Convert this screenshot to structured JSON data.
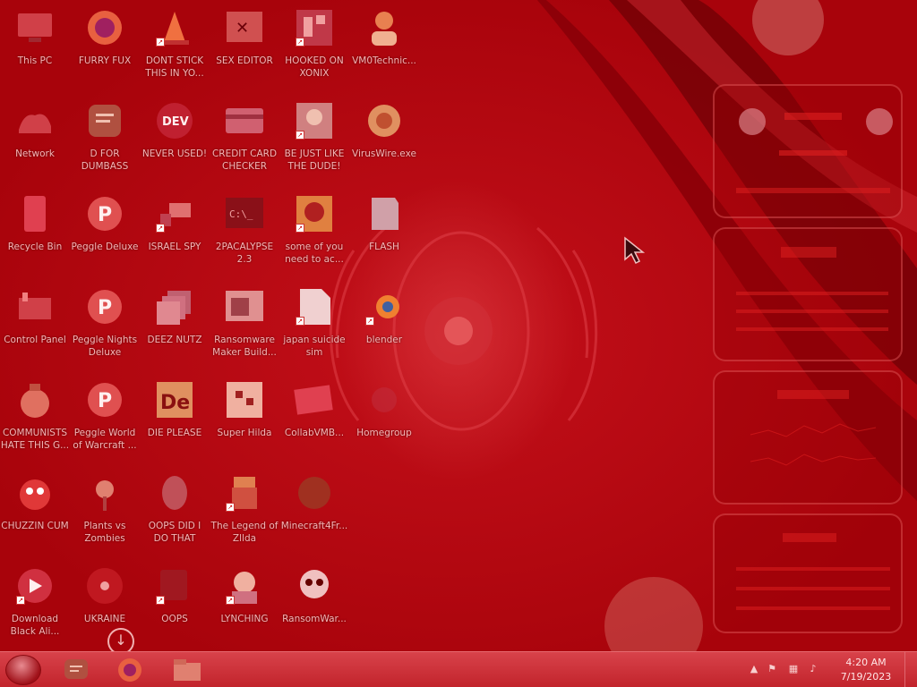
{
  "desktop": {
    "icons": [
      {
        "label": "This PC",
        "icon": "computer-icon"
      },
      {
        "label": "FURRY FUX",
        "icon": "firefox-icon"
      },
      {
        "label": "DONT STICK THIS IN YO...",
        "icon": "vlc-cone-icon"
      },
      {
        "label": "SEX EDITOR",
        "icon": "hex-editor-icon"
      },
      {
        "label": "HOOKED ON XONIX",
        "icon": "game-icon"
      },
      {
        "label": "VM0Technic...",
        "icon": "person-icon"
      },
      {
        "label": "Network",
        "icon": "network-icon"
      },
      {
        "label": "D FOR DUMBASS",
        "icon": "document-icon"
      },
      {
        "label": "NEVER USED!",
        "icon": "dev-badge-icon"
      },
      {
        "label": "CREDIT CARD CHECKER",
        "icon": "credit-card-icon"
      },
      {
        "label": "BE JUST LIKE THE DUDE!",
        "icon": "character-icon"
      },
      {
        "label": "VirusWire.exe",
        "icon": "virus-icon"
      },
      {
        "label": "Recycle Bin",
        "icon": "recycle-bin-icon"
      },
      {
        "label": "Peggle Deluxe",
        "icon": "peggle-icon"
      },
      {
        "label": "ISRAEL SPY",
        "icon": "spy-icon"
      },
      {
        "label": "2PACALYPSE 2.3",
        "icon": "terminal-icon"
      },
      {
        "label": "some of you need to ac...",
        "icon": "creature-icon"
      },
      {
        "label": "FLASH",
        "icon": "flash-icon"
      },
      {
        "label": "Control Panel",
        "icon": "control-panel-icon"
      },
      {
        "label": "Peggle Nights Deluxe",
        "icon": "peggle-icon"
      },
      {
        "label": "DEEZ NUTZ",
        "icon": "stack-icon"
      },
      {
        "label": "Ransomware Maker Build...",
        "icon": "window-icon"
      },
      {
        "label": "japan suicide sim",
        "icon": "file-icon"
      },
      {
        "label": "blender",
        "icon": "blender-icon"
      },
      {
        "label": "COMMUNISTS HATE THIS G...",
        "icon": "money-bag-icon"
      },
      {
        "label": "Peggle World of Warcraft ...",
        "icon": "peggle-icon"
      },
      {
        "label": "DIE PLEASE",
        "icon": "de-logo-icon"
      },
      {
        "label": "Super Hilda",
        "icon": "pixel-game-icon"
      },
      {
        "label": "CollabVMB...",
        "icon": "screen-icon"
      },
      {
        "label": "Homegroup",
        "icon": "homegroup-icon"
      },
      {
        "label": "CHUZZIN CUM",
        "icon": "chuzzle-icon"
      },
      {
        "label": "Plants vs Zombies",
        "icon": "plant-icon"
      },
      {
        "label": "OOPS DID I DO THAT",
        "icon": "portrait-icon"
      },
      {
        "label": "The Legend of Zllda",
        "icon": "zelda-icon"
      },
      {
        "label": "Minecraft4Fr...",
        "icon": "minecraft-icon"
      },
      {
        "label": "Download Black Ali...",
        "icon": "download-icon"
      },
      {
        "label": "UKRAINE",
        "icon": "radiation-icon"
      },
      {
        "label": "OOPS",
        "icon": "app-icon"
      },
      {
        "label": "LYNCHING",
        "icon": "character-icon"
      },
      {
        "label": "RansomWar...",
        "icon": "skull-icon"
      }
    ]
  },
  "taskbar": {
    "pinned": [
      {
        "name": "file-explorer",
        "icon": "chat-document-icon"
      },
      {
        "name": "firefox",
        "icon": "firefox-icon"
      },
      {
        "name": "folder",
        "icon": "folder-icon"
      }
    ],
    "clock": {
      "time": "4:20 AM",
      "date": "7/19/2023"
    }
  },
  "colors": {
    "desktop_bg": "#b0020a",
    "taskbar": "#c8303a",
    "label_text": "#f4b7b7"
  }
}
